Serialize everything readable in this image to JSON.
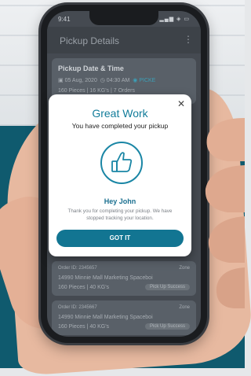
{
  "status_bar": {
    "time": "9:41",
    "icons": "▂▄▆ ◈ ▭"
  },
  "app_bar": {
    "title": "Pickup Details",
    "back_icon": "chevron-left-icon",
    "more_icon": "more-vertical-icon"
  },
  "pickup_card": {
    "heading": "Pickup Date & Time",
    "date": "05 Aug, 2020",
    "time": "04:30 AM",
    "status": "PICKE",
    "pieces": "160 Pieces",
    "weight": "16 KG's",
    "orders": "7 Orders"
  },
  "list_items": [
    {
      "order": "Order ID: 2345657",
      "tag": "Zone",
      "address": "14990 Minnie Mall Marketing Spaceboi",
      "pieces": "160 Pieces",
      "weight": "40 KG's",
      "pill": "Pick Up Success"
    },
    {
      "order": "Order ID: 2345667",
      "tag": "Zone",
      "address": "14990 Minnie Mall Marketing Spaceboi",
      "pieces": "160 Pieces",
      "weight": "40 KG's",
      "pill": "Pick Up Success"
    }
  ],
  "modal": {
    "title": "Great Work",
    "subtitle": "You have completed your pickup",
    "greeting": "Hey John",
    "body": "Thank you for completing your pickup. We have stopped tracking your location.",
    "button_label": "GOT IT",
    "close_icon": "close-icon",
    "badge_icon": "thumbs-up-icon"
  },
  "colors": {
    "accent": "#127c9a",
    "button": "#127592",
    "background_panel": "#0f5a6e"
  }
}
